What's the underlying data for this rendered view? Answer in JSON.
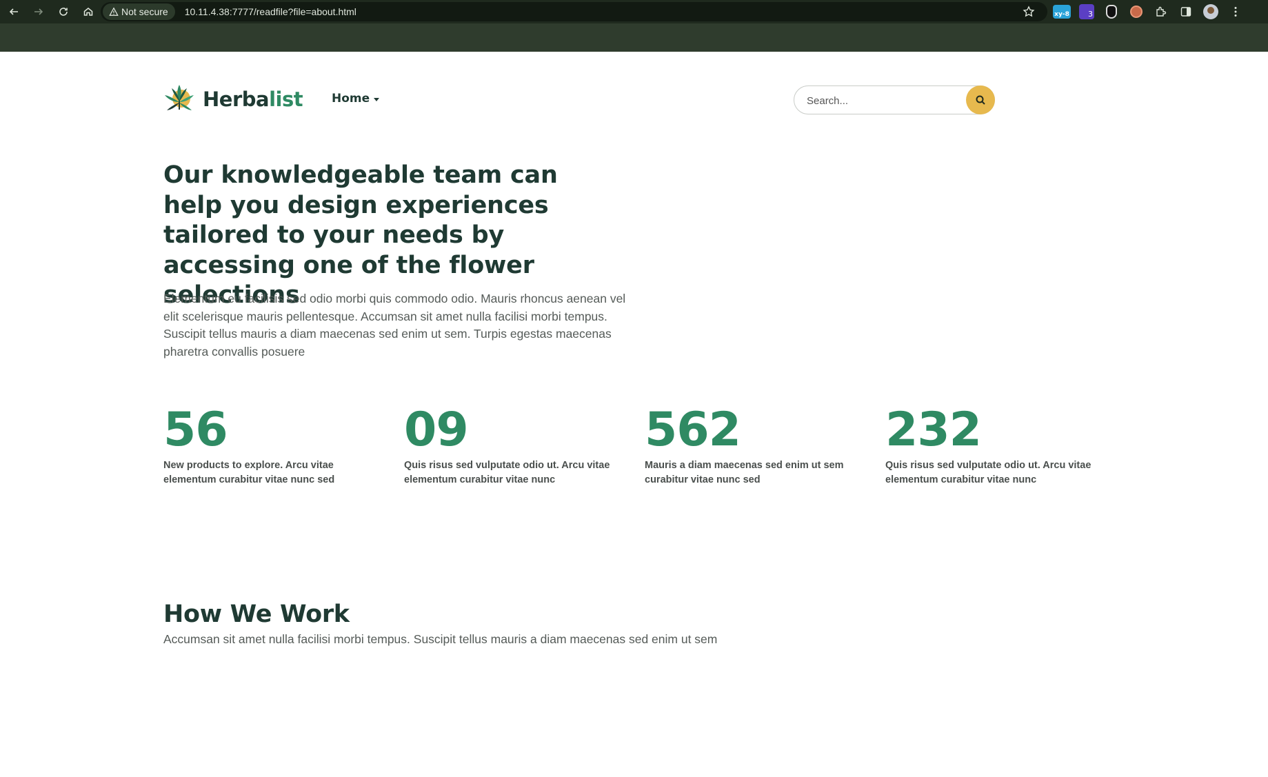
{
  "browser": {
    "security_label": "Not secure",
    "url": "10.11.4.38:7777/readfile?file=about.html",
    "extensions": [
      {
        "name": "xy-ext",
        "label": "xy-8"
      },
      {
        "name": "badge-ext",
        "label": "3"
      }
    ]
  },
  "site": {
    "logo_main": "Herba",
    "logo_accent": "list",
    "nav_home": "Home",
    "search_placeholder": "Search...",
    "colors": {
      "accent_green": "#2f8a63",
      "dark_green": "#1f3a33",
      "search_button": "#e7b94e"
    }
  },
  "hero": {
    "title": "Our knowledgeable team can help you design experiences tailored to your needs by accessing one of the flower selections",
    "body": "Elementum eu facilisis sed odio morbi quis commodo odio. Mauris rhoncus aenean vel elit scelerisque mauris pellentesque. Accumsan sit amet nulla facilisi morbi tempus. Suscipit tellus mauris a diam maecenas sed enim ut sem. Turpis egestas maecenas pharetra convallis posuere"
  },
  "stats": [
    {
      "number": "56",
      "text": "New products to explore. Arcu vitae elementum curabitur vitae nunc sed"
    },
    {
      "number": "09",
      "text": "Quis risus sed vulputate odio ut. Arcu vitae elementum curabitur vitae nunc"
    },
    {
      "number": "562",
      "text": "Mauris a diam maecenas sed enim ut sem curabitur vitae nunc sed"
    },
    {
      "number": "232",
      "text": "Quis risus sed vulputate odio ut. Arcu vitae elementum curabitur vitae nunc"
    }
  ],
  "how_we_work": {
    "title": "How We Work",
    "subtitle": "Accumsan sit amet nulla facilisi morbi tempus. Suscipit tellus mauris a diam maecenas sed enim ut sem"
  }
}
